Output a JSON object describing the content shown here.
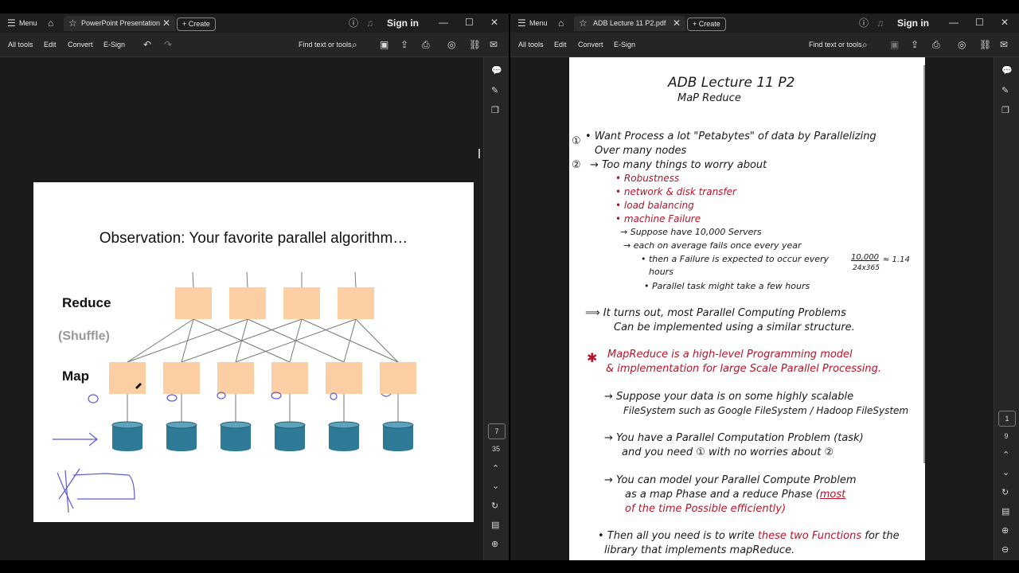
{
  "left_window": {
    "menu_label": "Menu",
    "tab_title": "PowerPoint Presentation",
    "create_label": "Create",
    "signin_label": "Sign in",
    "toolbar": {
      "all_tools": "All tools",
      "edit": "Edit",
      "convert": "Convert",
      "esign": "E-Sign",
      "find": "Find text or tools"
    },
    "page_current": "7",
    "page_total": "35",
    "slide": {
      "title": "Observation: Your favorite parallel algorithm…",
      "label_reduce": "Reduce",
      "label_shuffle": "(Shuffle)",
      "label_map": "Map"
    }
  },
  "right_window": {
    "menu_label": "Menu",
    "tab_title": "ADB Lecture 11 P2.pdf",
    "create_label": "Create",
    "signin_label": "Sign in",
    "toolbar": {
      "all_tools": "All tools",
      "edit": "Edit",
      "convert": "Convert",
      "esign": "E-Sign",
      "find": "Find text or tools"
    },
    "page_current": "1",
    "page_total": "9",
    "notes": {
      "title1": "ADB Lecture 11 P2",
      "title2": "MaP Reduce",
      "n1_marker": "①",
      "n1_line1": "• Want Process a lot \"Petabytes\" of data by Parallelizing",
      "n1_line2": "Over many nodes",
      "n2_marker": "②",
      "n2_line": "→ Too many things to worry about",
      "b_robustness": "• Robustness",
      "b_network": "• network & disk transfer",
      "b_load": "• load balancing",
      "b_machine": "• machine Failure",
      "s_suppose": "→ Suppose have 10,000 Servers",
      "s_each": "→ each on average fails once every year",
      "s_then": "• then a Failure is expected to occur every",
      "s_frac_num": "10,000",
      "s_frac_den": "24x365",
      "s_approx": "≈ 1.14",
      "s_hours": "hours",
      "s_parallel": "• Parallel task might take a few hours",
      "turns1": "⟹ It turns out, most Parallel Computing Problems",
      "turns2": "Can be implemented using a similar structure.",
      "star": "✱",
      "mr1": "MapReduce is a high-level Programming model",
      "mr2": "& implementation for large Scale Parallel Processing.",
      "sup1": "→ Suppose your data is on some highly scalable",
      "sup2": "FileSystem such as Google FileSystem / Hadoop FileSystem",
      "prob1": "→ You have a Parallel Computation Problem (task)",
      "prob2": "and you need ① with no worries about ②",
      "model1": "→ You can model your Parallel Compute Problem",
      "model2a": "as a map Phase and a reduce Phase (",
      "model2b": "most",
      "model3": "of the time Possible efficiently)",
      "then1a": "• Then all you need is to write ",
      "then1b": "these two Functions",
      "then1c": " for the",
      "then2": "library that implements mapReduce."
    }
  }
}
